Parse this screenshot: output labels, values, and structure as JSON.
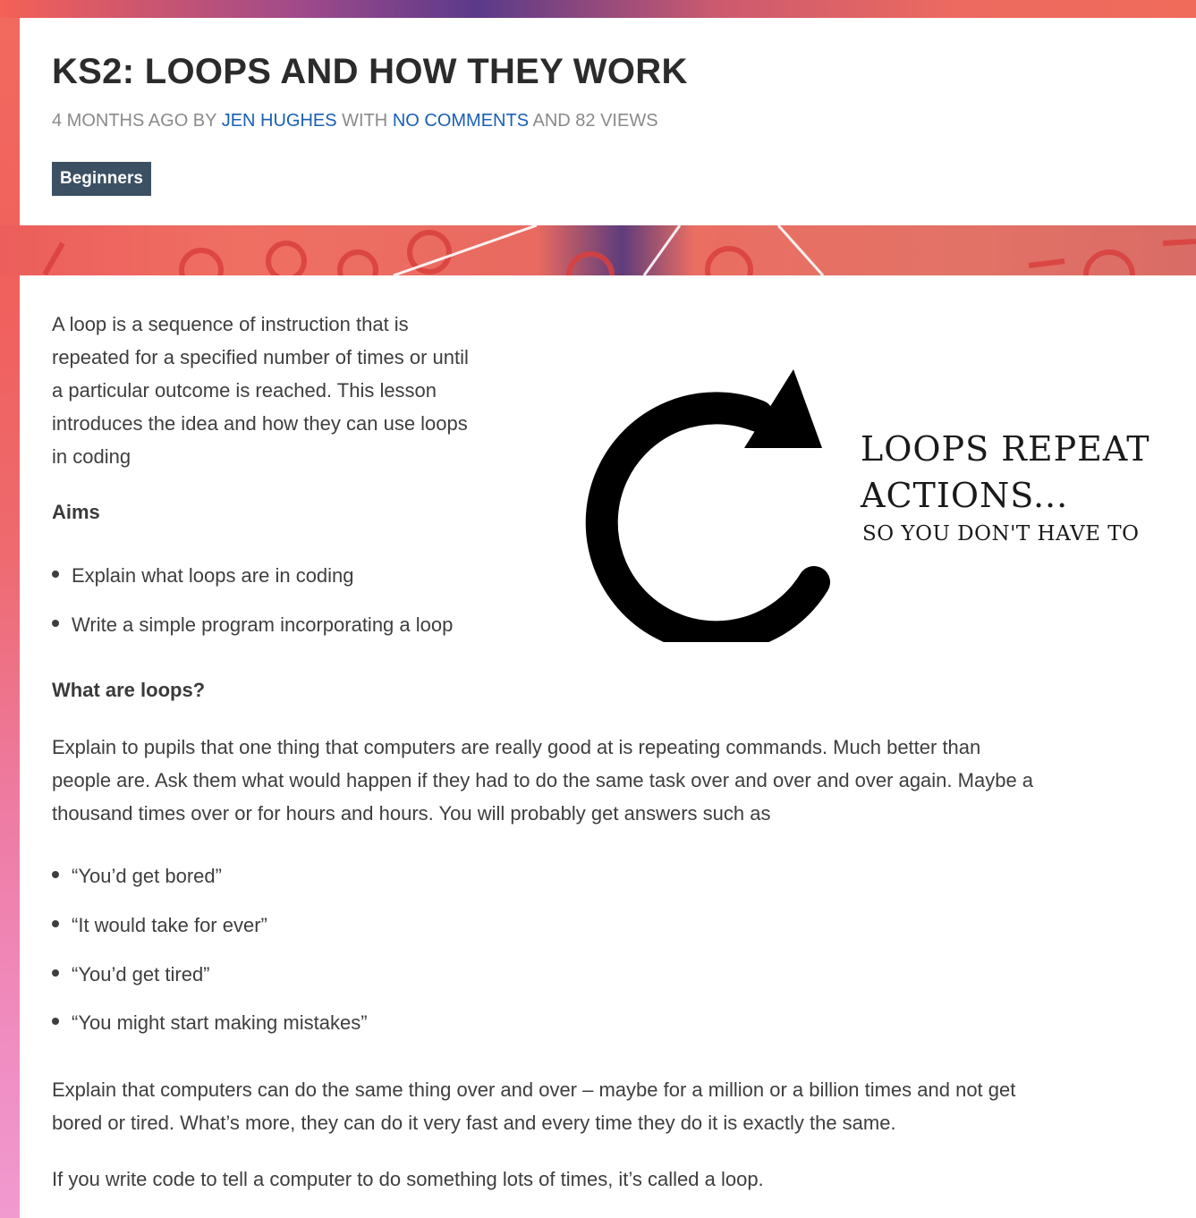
{
  "post": {
    "title": "KS2: LOOPS AND HOW THEY WORK",
    "meta": {
      "age": "4 MONTHS AGO BY",
      "author": "JEN HUGHES",
      "with": "WITH",
      "comments": "NO COMMENTS",
      "and": "AND",
      "views": "82 VIEWS"
    },
    "tag": "Beginners"
  },
  "intro": {
    "lines": [
      "A loop is a sequence of instruction that is",
      "repeated for a specified number of times or until",
      "a particular outcome is reached.  This lesson",
      "introduces the idea and how they can use loops",
      "in coding"
    ]
  },
  "graphic": {
    "headline_line1": "LOOPS REPEAT",
    "headline_line2": "ACTIONS...",
    "subline": "SO YOU DON'T HAVE TO",
    "icon": "refresh-arrow-icon"
  },
  "aims": {
    "heading": "Aims",
    "items": [
      "Explain what loops are in coding",
      "Write a simple program incorporating a loop"
    ]
  },
  "what_are_loops": {
    "heading": "What are loops?",
    "paragraph_lines": [
      "Explain to pupils that one thing that computers are really good at is repeating commands.  Much better than",
      "people are.  Ask them what would happen if they had to do the same task over and over and over again. Maybe a",
      "thousand times over or for hours and hours. You will probably get answers such as"
    ],
    "answers": [
      "“You’d get bored”",
      "“It would take for ever”",
      "“You’d get tired”",
      "“You might start making mistakes”"
    ],
    "explain_lines": [
      "Explain that computers can do the same thing over and over – maybe for a million or a billion times and not get",
      "bored or tired. What’s more, they can do it very fast and every time they do it is exactly the same."
    ],
    "closing": "If you write code to tell a computer to do something lots of times, it’s called a loop."
  },
  "colors": {
    "tag_bg": "#3c5063",
    "link": "#1a5fb4",
    "title": "#2b2b2b",
    "body_text": "#3e3e3e"
  }
}
